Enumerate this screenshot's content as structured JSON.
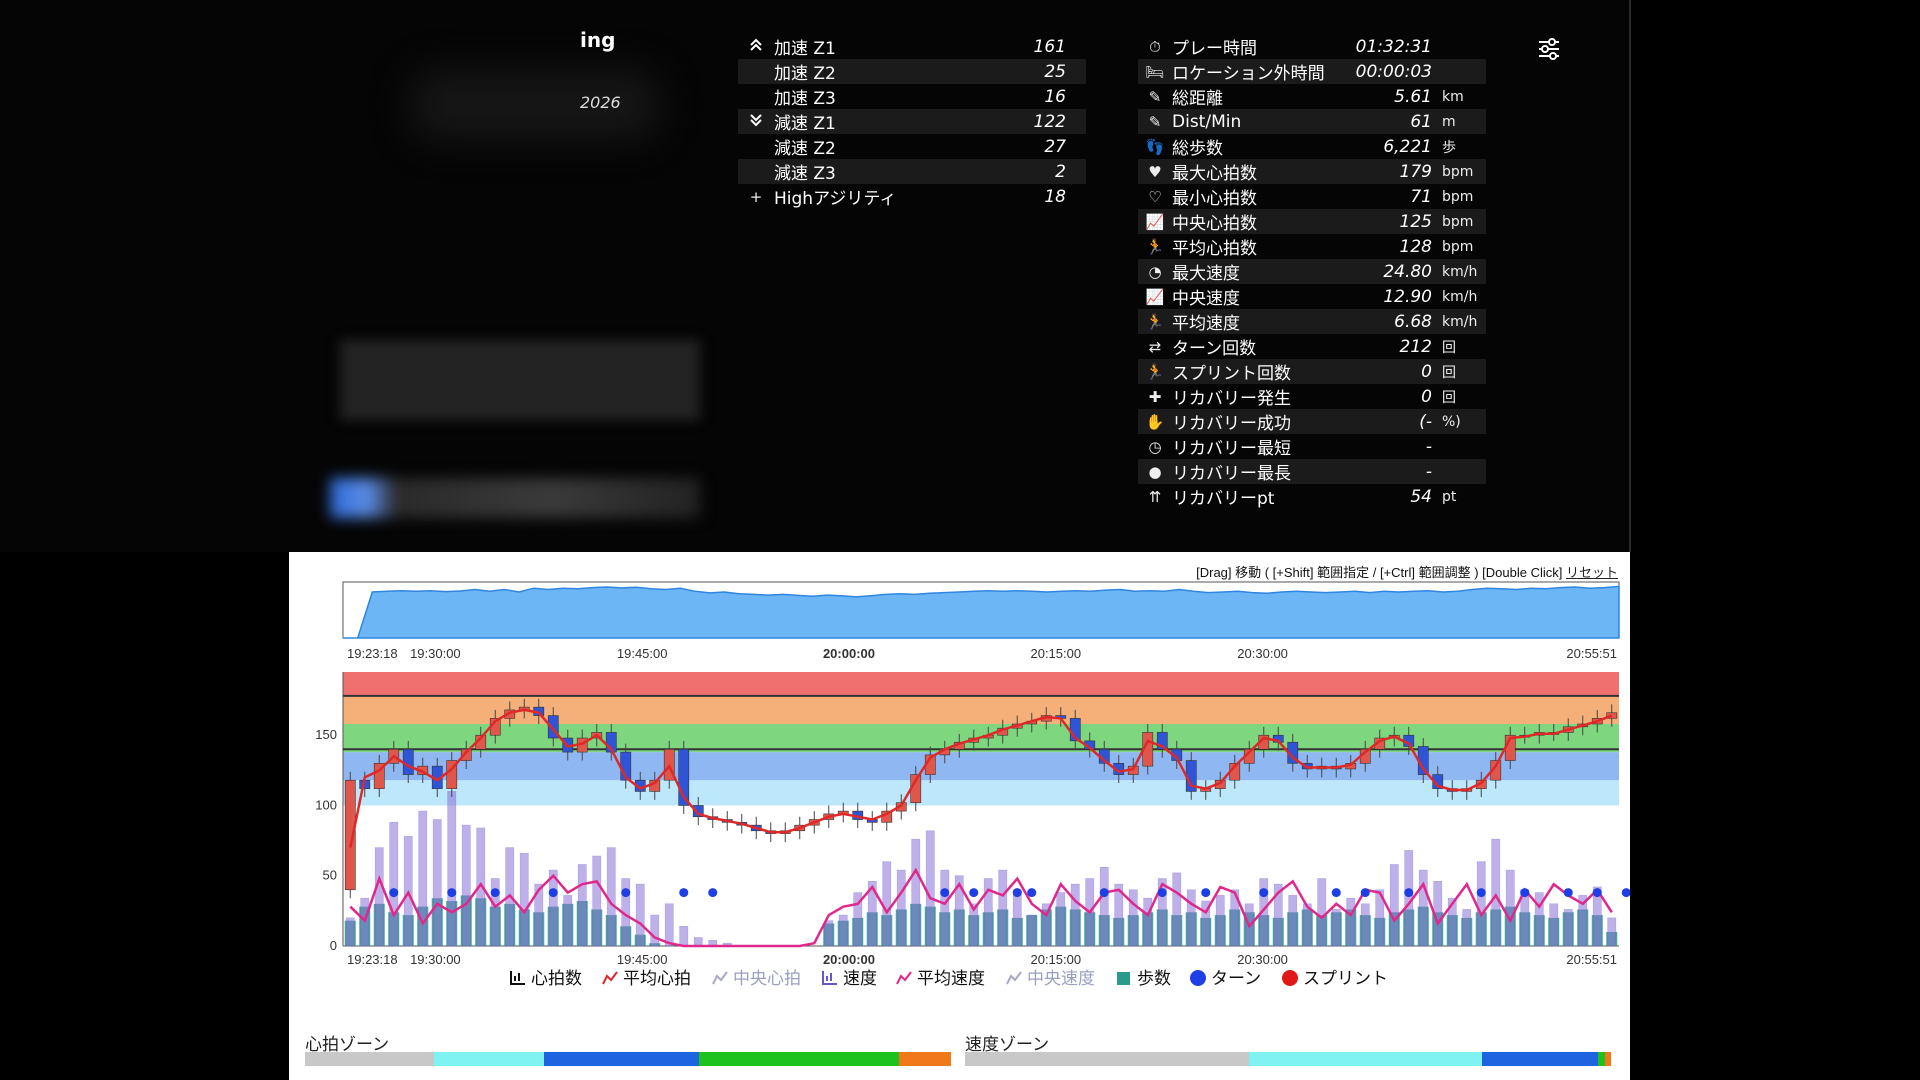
{
  "header": {
    "title_fragment": "ing",
    "year_fragment": "2026"
  },
  "agility": [
    {
      "icon": "chevrons-up-icon",
      "label": "加速 Z1",
      "value": "161"
    },
    {
      "icon": "",
      "label": "加速 Z2",
      "value": "25"
    },
    {
      "icon": "",
      "label": "加速 Z3",
      "value": "16"
    },
    {
      "icon": "chevrons-down-icon",
      "label": "減速 Z1",
      "value": "122"
    },
    {
      "icon": "",
      "label": "減速 Z2",
      "value": "27"
    },
    {
      "icon": "",
      "label": "減速 Z3",
      "value": "2"
    },
    {
      "icon": "plus-icon",
      "label": "Highアジリティ",
      "value": "18"
    }
  ],
  "stats": [
    {
      "icon": "stopwatch-icon",
      "glyph": "⏱",
      "label": "プレー時間",
      "value": "01:32:31",
      "unit": ""
    },
    {
      "icon": "bed-icon",
      "glyph": "🛏",
      "label": "ロケーション外時間",
      "value": "00:00:03",
      "unit": ""
    },
    {
      "icon": "ruler-icon",
      "glyph": "✎",
      "label": "総距離",
      "value": "5.61",
      "unit": "km"
    },
    {
      "icon": "ruler-icon",
      "glyph": "✎",
      "label": "Dist/Min",
      "value": "61",
      "unit": "m"
    },
    {
      "icon": "footsteps-icon",
      "glyph": "👣",
      "label": "総歩数",
      "value": "6,221",
      "unit": "歩"
    },
    {
      "icon": "heart-pulse-icon",
      "glyph": "♥",
      "label": "最大心拍数",
      "value": "179",
      "unit": "bpm"
    },
    {
      "icon": "heart-outline-icon",
      "glyph": "♡",
      "label": "最小心拍数",
      "value": "71",
      "unit": "bpm"
    },
    {
      "icon": "line-chart-icon",
      "glyph": "📈",
      "label": "中央心拍数",
      "value": "125",
      "unit": "bpm"
    },
    {
      "icon": "runner-speed-icon",
      "glyph": "🏃",
      "label": "平均心拍数",
      "value": "128",
      "unit": "bpm"
    },
    {
      "icon": "speedometer-icon",
      "glyph": "◔",
      "label": "最大速度",
      "value": "24.80",
      "unit": "km/h"
    },
    {
      "icon": "line-chart-icon",
      "glyph": "📈",
      "label": "中央速度",
      "value": "12.90",
      "unit": "km/h"
    },
    {
      "icon": "runner-speed-icon",
      "glyph": "🏃",
      "label": "平均速度",
      "value": "6.68",
      "unit": "km/h"
    },
    {
      "icon": "swap-arrows-icon",
      "glyph": "⇄",
      "label": "ターン回数",
      "value": "212",
      "unit": "回"
    },
    {
      "icon": "sprint-icon",
      "glyph": "🏃",
      "label": "スプリント回数",
      "value": "0",
      "unit": "回"
    },
    {
      "icon": "medkit-icon",
      "glyph": "✚",
      "label": "リカバリー発生",
      "value": "0",
      "unit": "回"
    },
    {
      "icon": "hand-heart-icon",
      "glyph": "✋",
      "label": "リカバリー成功",
      "value": "(-",
      "unit": "%)"
    },
    {
      "icon": "clock-outline-icon",
      "glyph": "◷",
      "label": "リカバリー最短",
      "value": "-",
      "unit": ""
    },
    {
      "icon": "clock-filled-icon",
      "glyph": "●",
      "label": "リカバリー最長",
      "value": "-",
      "unit": ""
    },
    {
      "icon": "arrows-up-icon",
      "glyph": "⇈",
      "label": "リカバリーpt",
      "value": "54",
      "unit": "pt"
    }
  ],
  "chart_hint": {
    "text": "[Drag] 移動 ( [+Shift] 範囲指定 / [+Ctrl] 範囲調整 ) [Double Click]",
    "reset": "リセット"
  },
  "chart_data": [
    {
      "type": "area",
      "name": "overview",
      "x_ticks": [
        {
          "label": "19:23:18",
          "min": 0,
          "bold": false
        },
        {
          "label": "19:30:00",
          "min": 6.7,
          "bold": false
        },
        {
          "label": "19:45:00",
          "min": 21.7,
          "bold": false
        },
        {
          "label": "20:00:00",
          "min": 36.7,
          "bold": true
        },
        {
          "label": "20:15:00",
          "min": 51.7,
          "bold": false
        },
        {
          "label": "20:30:00",
          "min": 66.7,
          "bold": false
        },
        {
          "label": "20:55:51",
          "min": 92.55,
          "bold": false
        }
      ],
      "x_range_min": [
        0,
        92.55
      ],
      "y_range": [
        0,
        180
      ],
      "values": [
        0,
        0,
        148,
        150,
        152,
        150,
        152,
        149,
        151,
        156,
        150,
        156,
        148,
        160,
        156,
        160,
        158,
        162,
        164,
        161,
        163,
        158,
        156,
        160,
        150,
        145,
        148,
        142,
        140,
        138,
        140,
        137,
        134,
        138,
        136,
        132,
        136,
        140,
        142,
        140,
        144,
        146,
        148,
        150,
        152,
        150,
        152,
        150,
        148,
        150,
        152,
        150,
        154,
        156,
        150,
        152,
        150,
        156,
        150,
        146,
        148,
        150,
        146,
        144,
        148,
        150,
        148,
        146,
        148,
        150,
        146,
        150,
        148,
        150,
        152,
        148,
        150,
        156,
        160,
        158,
        156,
        160,
        158,
        162,
        164,
        160,
        162,
        166
      ]
    },
    {
      "type": "bar+line",
      "name": "main",
      "x_ticks": [
        {
          "label": "19:23:18",
          "min": 0,
          "bold": false
        },
        {
          "label": "19:30:00",
          "min": 6.7,
          "bold": false
        },
        {
          "label": "19:45:00",
          "min": 21.7,
          "bold": false
        },
        {
          "label": "20:00:00",
          "min": 36.7,
          "bold": true
        },
        {
          "label": "20:15:00",
          "min": 51.7,
          "bold": false
        },
        {
          "label": "20:30:00",
          "min": 66.7,
          "bold": false
        },
        {
          "label": "20:55:51",
          "min": 92.55,
          "bold": false
        }
      ],
      "y_ticks": [
        0,
        50,
        100,
        150
      ],
      "ylim": [
        0,
        195
      ],
      "hr_zone_bands": [
        {
          "from": 100,
          "to": 118,
          "color": "#bde7fa"
        },
        {
          "from": 118,
          "to": 138,
          "color": "#8fb8f2"
        },
        {
          "from": 138,
          "to": 158,
          "color": "#7ed77e"
        },
        {
          "from": 158,
          "to": 178,
          "color": "#f5b07a"
        },
        {
          "from": 178,
          "to": 195,
          "color": "#f07070"
        }
      ],
      "hr_ref_lines": [
        140,
        178
      ],
      "series": [
        {
          "name": "心拍数",
          "kind": "candle",
          "open": [
            40,
            118,
            112,
            130,
            140,
            122,
            128,
            112,
            132,
            140,
            150,
            162,
            168,
            170,
            164,
            148,
            138,
            148,
            152,
            138,
            118,
            110,
            118,
            140,
            100,
            92,
            90,
            88,
            86,
            82,
            80,
            82,
            86,
            90,
            94,
            96,
            90,
            88,
            96,
            102,
            122,
            136,
            140,
            145,
            148,
            150,
            155,
            158,
            160,
            164,
            162,
            146,
            140,
            130,
            122,
            128,
            152,
            140,
            132,
            110,
            112,
            118,
            130,
            140,
            150,
            145,
            130,
            126,
            128,
            126,
            130,
            140,
            148,
            150,
            142,
            122,
            112,
            110,
            112,
            118,
            132,
            150,
            150,
            152,
            152,
            156,
            158,
            162
          ],
          "close": [
            118,
            112,
            130,
            140,
            122,
            128,
            112,
            132,
            140,
            150,
            162,
            168,
            170,
            164,
            148,
            138,
            148,
            152,
            138,
            118,
            110,
            118,
            140,
            100,
            92,
            90,
            88,
            86,
            82,
            80,
            82,
            86,
            90,
            94,
            96,
            90,
            88,
            96,
            102,
            122,
            136,
            140,
            145,
            148,
            150,
            155,
            158,
            160,
            164,
            162,
            146,
            140,
            130,
            122,
            128,
            152,
            140,
            132,
            110,
            112,
            118,
            130,
            140,
            150,
            145,
            130,
            126,
            128,
            126,
            130,
            140,
            148,
            150,
            142,
            122,
            112,
            110,
            112,
            118,
            132,
            150,
            150,
            152,
            152,
            156,
            158,
            162,
            166
          ]
        },
        {
          "name": "平均心拍",
          "values": [
            70,
            120,
            125,
            135,
            128,
            124,
            118,
            126,
            138,
            148,
            160,
            166,
            168,
            166,
            154,
            142,
            144,
            150,
            140,
            120,
            112,
            116,
            128,
            106,
            94,
            91,
            89,
            87,
            84,
            81,
            81,
            84,
            88,
            92,
            94,
            92,
            90,
            94,
            100,
            118,
            134,
            140,
            144,
            147,
            150,
            154,
            157,
            160,
            163,
            162,
            148,
            141,
            132,
            124,
            126,
            146,
            142,
            134,
            114,
            112,
            116,
            128,
            138,
            148,
            146,
            134,
            127,
            127,
            127,
            129,
            138,
            146,
            149,
            144,
            126,
            114,
            111,
            111,
            116,
            128,
            148,
            149,
            151,
            151,
            154,
            157,
            160,
            164
          ]
        },
        {
          "name": "中央心拍",
          "values": []
        },
        {
          "name": "速度",
          "kind": "bar",
          "values": [
            20,
            34,
            70,
            88,
            78,
            96,
            90,
            110,
            86,
            84,
            48,
            70,
            66,
            44,
            54,
            36,
            58,
            64,
            70,
            48,
            44,
            22,
            30,
            14,
            6,
            4,
            2,
            0,
            0,
            0,
            0,
            0,
            0,
            18,
            22,
            38,
            46,
            60,
            54,
            76,
            82,
            54,
            50,
            30,
            48,
            54,
            40,
            22,
            30,
            38,
            44,
            48,
            56,
            44,
            40,
            34,
            48,
            52,
            40,
            32,
            36,
            40,
            30,
            48,
            44,
            36,
            30,
            48,
            26,
            34,
            30,
            40,
            58,
            68,
            54,
            46,
            34,
            26,
            60,
            76,
            54,
            40,
            38,
            30,
            26,
            36,
            42,
            20
          ]
        },
        {
          "name": "平均速度",
          "values": [
            28,
            18,
            48,
            22,
            38,
            16,
            30,
            24,
            30,
            44,
            28,
            36,
            24,
            40,
            50,
            38,
            44,
            46,
            30,
            22,
            16,
            6,
            2,
            0,
            0,
            0,
            0,
            0,
            0,
            0,
            0,
            0,
            2,
            22,
            28,
            30,
            42,
            24,
            38,
            54,
            34,
            30,
            44,
            26,
            40,
            36,
            48,
            30,
            22,
            44,
            32,
            24,
            38,
            40,
            30,
            22,
            44,
            38,
            30,
            24,
            42,
            38,
            14,
            26,
            38,
            46,
            28,
            20,
            30,
            22,
            40,
            38,
            18,
            30,
            44,
            16,
            30,
            44,
            22,
            36,
            18,
            40,
            28,
            44,
            36,
            30,
            40,
            24
          ]
        },
        {
          "name": "中央速度",
          "values": []
        },
        {
          "name": "歩数",
          "kind": "bar",
          "values": [
            18,
            28,
            30,
            24,
            22,
            28,
            34,
            32,
            36,
            34,
            28,
            30,
            26,
            24,
            28,
            30,
            32,
            26,
            22,
            14,
            8,
            2,
            0,
            0,
            0,
            0,
            0,
            0,
            0,
            0,
            0,
            0,
            0,
            16,
            18,
            20,
            24,
            22,
            26,
            30,
            28,
            24,
            26,
            22,
            24,
            26,
            20,
            22,
            26,
            28,
            26,
            24,
            22,
            20,
            22,
            24,
            26,
            22,
            24,
            20,
            22,
            26,
            24,
            22,
            20,
            24,
            26,
            22,
            24,
            26,
            22,
            20,
            24,
            26,
            28,
            24,
            22,
            20,
            24,
            26,
            28,
            24,
            22,
            20,
            24,
            26,
            22,
            10
          ]
        },
        {
          "name": "ターン",
          "kind": "marker",
          "color": "#1f3fe6",
          "level": 38,
          "indices": [
            3,
            7,
            10,
            14,
            19,
            23,
            25,
            41,
            43,
            46,
            47,
            52,
            56,
            59,
            63,
            68,
            70,
            73,
            78,
            81,
            84,
            86,
            88
          ]
        },
        {
          "name": "スプリント",
          "kind": "marker",
          "color": "#e01818",
          "level": 38,
          "indices": []
        }
      ],
      "legend": [
        {
          "label": "心拍数",
          "icon": "candlestick-icon",
          "color": "#111",
          "muted": false
        },
        {
          "label": "平均心拍",
          "icon": "line-chart-icon",
          "color": "#e02828",
          "muted": false
        },
        {
          "label": "中央心拍",
          "icon": "line-chart-icon",
          "color": "#9aaee8",
          "muted": true
        },
        {
          "label": "速度",
          "icon": "candlestick-icon",
          "color": "#6a54c8",
          "muted": false
        },
        {
          "label": "平均速度",
          "icon": "line-chart-icon",
          "color": "#e0288c",
          "muted": false
        },
        {
          "label": "中央速度",
          "icon": "line-chart-icon",
          "color": "#d7b6e8",
          "muted": true
        },
        {
          "label": "歩数",
          "icon": "square",
          "color": "#2a9a8a",
          "muted": false
        },
        {
          "label": "ターン",
          "icon": "circle",
          "color": "#1f3fe6",
          "muted": false
        },
        {
          "label": "スプリント",
          "icon": "circle",
          "color": "#e01818",
          "muted": false
        }
      ]
    }
  ],
  "zones": {
    "hr_label": "心拍ゾーン",
    "speed_label": "速度ゾーン",
    "hr": [
      {
        "share": 0.2,
        "color": "#c8c8c8"
      },
      {
        "share": 0.17,
        "color": "#7ff2f2"
      },
      {
        "share": 0.24,
        "color": "#1e63e0"
      },
      {
        "share": 0.31,
        "color": "#1ec21e"
      },
      {
        "share": 0.08,
        "color": "#f07a1a"
      }
    ],
    "speed": [
      {
        "share": 0.44,
        "color": "#c8c8c8"
      },
      {
        "share": 0.36,
        "color": "#7ff2f2"
      },
      {
        "share": 0.18,
        "color": "#1e63e0"
      },
      {
        "share": 0.01,
        "color": "#1ec21e"
      },
      {
        "share": 0.01,
        "color": "#f07a1a"
      }
    ]
  }
}
